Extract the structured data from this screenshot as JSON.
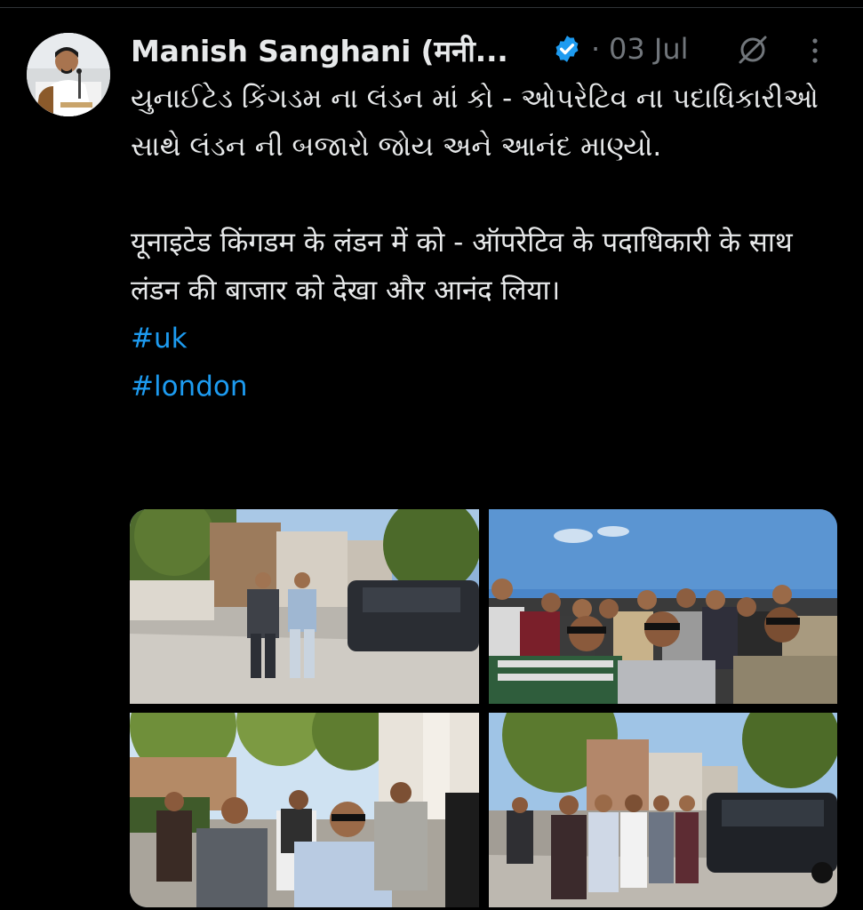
{
  "author": {
    "display_name": "Manish Sanghani (मनी...",
    "verified": true,
    "avatar": "author-avatar-photo"
  },
  "meta": {
    "separator": "·",
    "date": "03 Jul"
  },
  "icons": {
    "verified": "verified-badge-icon",
    "grok": "grok-icon",
    "more": "more-options-icon"
  },
  "tweet": {
    "gujarati_text": "યુનાઈટેડ કિંગડમ ના લંડન માં કો - ઓપરેટિવ ના પદાધિકારીઓ સાથે લંડન ની બજારો જોય અને આનંદ માણ્યો.",
    "hindi_text": "यूनाइटेड किंगडम के लंडन में को - ऑपरेटिव के पदाधिकारी के साथ लंडन की बाजार को देखा और आनंद लिया।",
    "hashtags": [
      "#uk",
      "#london"
    ]
  },
  "media": {
    "photo_count": 4
  },
  "colors": {
    "background": "#000000",
    "text": "#e7e9ea",
    "muted": "#71767b",
    "link": "#1d9bf0",
    "verified": "#1d9bf0"
  }
}
